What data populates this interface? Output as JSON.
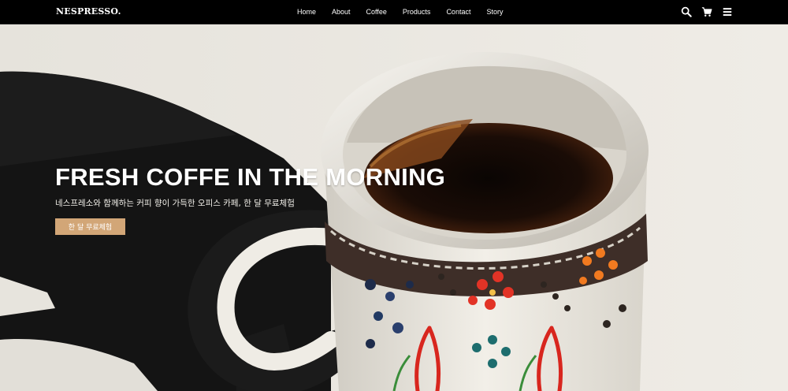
{
  "header": {
    "logo": "NESPRESSO.",
    "nav": [
      "Home",
      "About",
      "Coffee",
      "Products",
      "Contact",
      "Story"
    ],
    "icons": [
      "search-icon",
      "cart-icon",
      "menu-icon"
    ]
  },
  "hero": {
    "title": "FRESH COFFE IN THE MORNING",
    "subtitle": "네스프레소와 함께하는 커피 향이 가득한 오피스 카페, 한 달 무료체험",
    "button_label": "한 달 무료체험",
    "button_color": "#d2a677"
  }
}
